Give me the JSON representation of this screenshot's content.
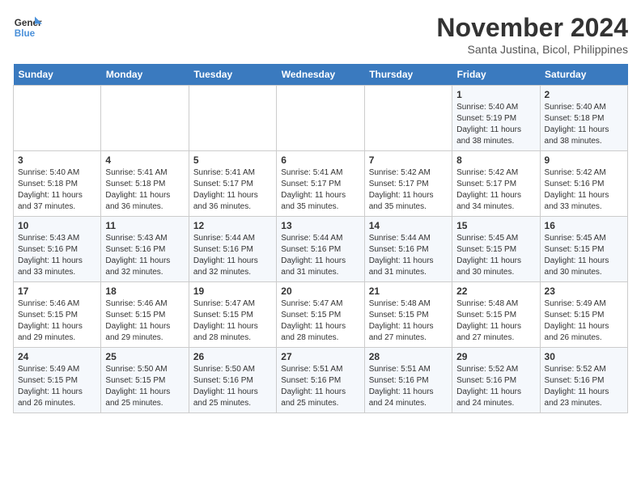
{
  "header": {
    "logo_line1": "General",
    "logo_line2": "Blue",
    "month": "November 2024",
    "location": "Santa Justina, Bicol, Philippines"
  },
  "weekdays": [
    "Sunday",
    "Monday",
    "Tuesday",
    "Wednesday",
    "Thursday",
    "Friday",
    "Saturday"
  ],
  "weeks": [
    [
      {
        "day": "",
        "info": ""
      },
      {
        "day": "",
        "info": ""
      },
      {
        "day": "",
        "info": ""
      },
      {
        "day": "",
        "info": ""
      },
      {
        "day": "",
        "info": ""
      },
      {
        "day": "1",
        "info": "Sunrise: 5:40 AM\nSunset: 5:19 PM\nDaylight: 11 hours and 38 minutes."
      },
      {
        "day": "2",
        "info": "Sunrise: 5:40 AM\nSunset: 5:18 PM\nDaylight: 11 hours and 38 minutes."
      }
    ],
    [
      {
        "day": "3",
        "info": "Sunrise: 5:40 AM\nSunset: 5:18 PM\nDaylight: 11 hours and 37 minutes."
      },
      {
        "day": "4",
        "info": "Sunrise: 5:41 AM\nSunset: 5:18 PM\nDaylight: 11 hours and 36 minutes."
      },
      {
        "day": "5",
        "info": "Sunrise: 5:41 AM\nSunset: 5:17 PM\nDaylight: 11 hours and 36 minutes."
      },
      {
        "day": "6",
        "info": "Sunrise: 5:41 AM\nSunset: 5:17 PM\nDaylight: 11 hours and 35 minutes."
      },
      {
        "day": "7",
        "info": "Sunrise: 5:42 AM\nSunset: 5:17 PM\nDaylight: 11 hours and 35 minutes."
      },
      {
        "day": "8",
        "info": "Sunrise: 5:42 AM\nSunset: 5:17 PM\nDaylight: 11 hours and 34 minutes."
      },
      {
        "day": "9",
        "info": "Sunrise: 5:42 AM\nSunset: 5:16 PM\nDaylight: 11 hours and 33 minutes."
      }
    ],
    [
      {
        "day": "10",
        "info": "Sunrise: 5:43 AM\nSunset: 5:16 PM\nDaylight: 11 hours and 33 minutes."
      },
      {
        "day": "11",
        "info": "Sunrise: 5:43 AM\nSunset: 5:16 PM\nDaylight: 11 hours and 32 minutes."
      },
      {
        "day": "12",
        "info": "Sunrise: 5:44 AM\nSunset: 5:16 PM\nDaylight: 11 hours and 32 minutes."
      },
      {
        "day": "13",
        "info": "Sunrise: 5:44 AM\nSunset: 5:16 PM\nDaylight: 11 hours and 31 minutes."
      },
      {
        "day": "14",
        "info": "Sunrise: 5:44 AM\nSunset: 5:16 PM\nDaylight: 11 hours and 31 minutes."
      },
      {
        "day": "15",
        "info": "Sunrise: 5:45 AM\nSunset: 5:15 PM\nDaylight: 11 hours and 30 minutes."
      },
      {
        "day": "16",
        "info": "Sunrise: 5:45 AM\nSunset: 5:15 PM\nDaylight: 11 hours and 30 minutes."
      }
    ],
    [
      {
        "day": "17",
        "info": "Sunrise: 5:46 AM\nSunset: 5:15 PM\nDaylight: 11 hours and 29 minutes."
      },
      {
        "day": "18",
        "info": "Sunrise: 5:46 AM\nSunset: 5:15 PM\nDaylight: 11 hours and 29 minutes."
      },
      {
        "day": "19",
        "info": "Sunrise: 5:47 AM\nSunset: 5:15 PM\nDaylight: 11 hours and 28 minutes."
      },
      {
        "day": "20",
        "info": "Sunrise: 5:47 AM\nSunset: 5:15 PM\nDaylight: 11 hours and 28 minutes."
      },
      {
        "day": "21",
        "info": "Sunrise: 5:48 AM\nSunset: 5:15 PM\nDaylight: 11 hours and 27 minutes."
      },
      {
        "day": "22",
        "info": "Sunrise: 5:48 AM\nSunset: 5:15 PM\nDaylight: 11 hours and 27 minutes."
      },
      {
        "day": "23",
        "info": "Sunrise: 5:49 AM\nSunset: 5:15 PM\nDaylight: 11 hours and 26 minutes."
      }
    ],
    [
      {
        "day": "24",
        "info": "Sunrise: 5:49 AM\nSunset: 5:15 PM\nDaylight: 11 hours and 26 minutes."
      },
      {
        "day": "25",
        "info": "Sunrise: 5:50 AM\nSunset: 5:15 PM\nDaylight: 11 hours and 25 minutes."
      },
      {
        "day": "26",
        "info": "Sunrise: 5:50 AM\nSunset: 5:16 PM\nDaylight: 11 hours and 25 minutes."
      },
      {
        "day": "27",
        "info": "Sunrise: 5:51 AM\nSunset: 5:16 PM\nDaylight: 11 hours and 25 minutes."
      },
      {
        "day": "28",
        "info": "Sunrise: 5:51 AM\nSunset: 5:16 PM\nDaylight: 11 hours and 24 minutes."
      },
      {
        "day": "29",
        "info": "Sunrise: 5:52 AM\nSunset: 5:16 PM\nDaylight: 11 hours and 24 minutes."
      },
      {
        "day": "30",
        "info": "Sunrise: 5:52 AM\nSunset: 5:16 PM\nDaylight: 11 hours and 23 minutes."
      }
    ]
  ]
}
